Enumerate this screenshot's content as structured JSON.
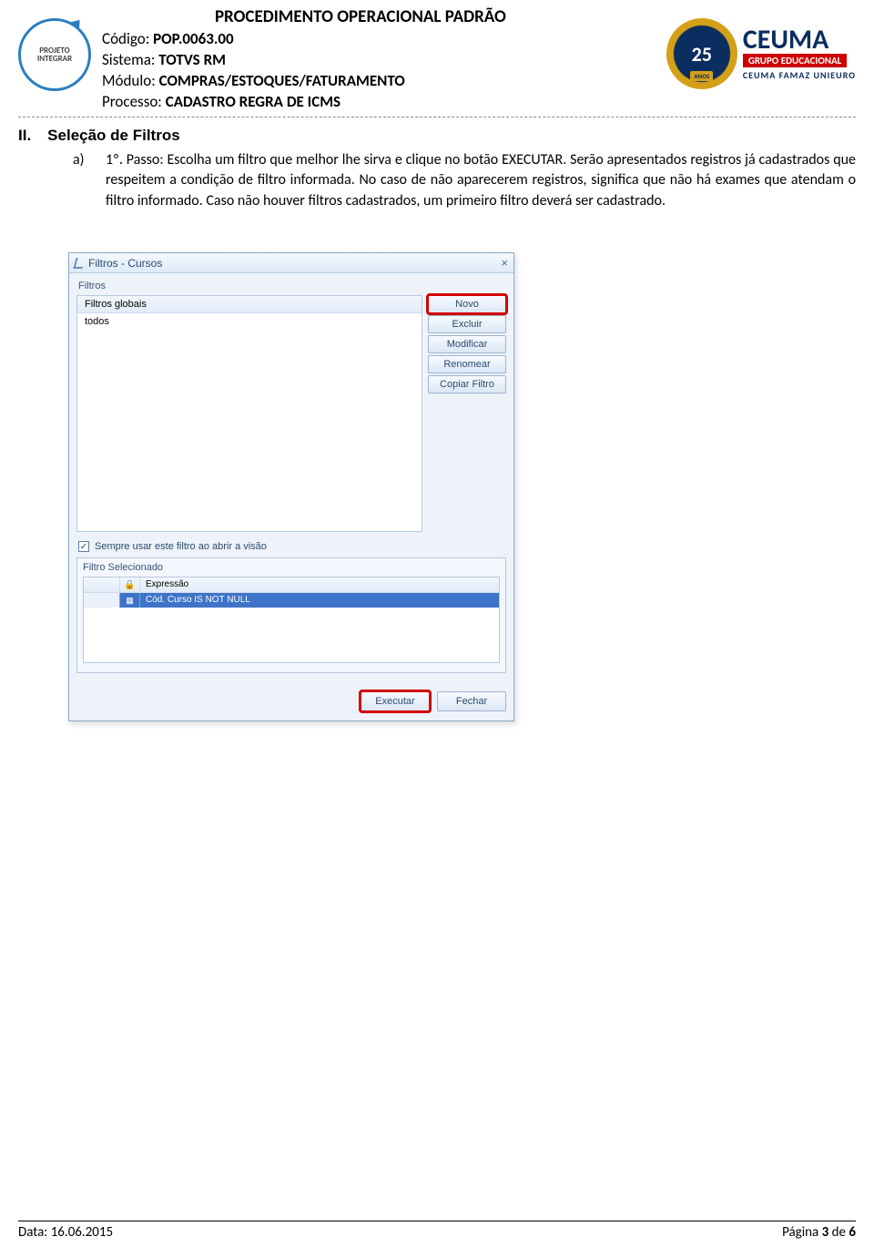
{
  "header": {
    "title": "PROCEDIMENTO OPERACIONAL PADRÃO",
    "codigo_label": "Código: ",
    "codigo_value": "POP.0063.00",
    "sistema_label": "Sistema: ",
    "sistema_value": "TOTVS RM",
    "modulo_label": "Módulo: ",
    "modulo_value": "COMPRAS/ESTOQUES/FATURAMENTO",
    "processo_label": "Processo: ",
    "processo_value": "CADASTRO REGRA DE ICMS",
    "logo_integrar_line1": "PROJETO",
    "logo_integrar_line2": "INTEGRAR",
    "badge_number": "25",
    "ceuma_main": "CEUMA",
    "ceuma_sub": "GRUPO EDUCACIONAL",
    "ceuma_line": "CEUMA FAMAZ UNIEURO"
  },
  "section": {
    "num": "II.",
    "title": "Seleção de Filtros",
    "item_letter": "a)",
    "item_text": "1º. Passo: Escolha um filtro que melhor lhe sirva e clique no botão EXECUTAR. Serão apresentados registros já cadastrados que respeitem a condição de filtro informada. No caso de não aparecerem registros, significa que não há exames que atendam o filtro informado. Caso não houver filtros cadastrados, um primeiro filtro deverá ser cadastrado."
  },
  "window": {
    "title": "Filtros - Cursos",
    "close": "×",
    "group_filtros": "Filtros",
    "list_header": "Filtros globais",
    "list_item": "todos",
    "buttons": {
      "novo": "Novo",
      "excluir": "Excluir",
      "modificar": "Modificar",
      "renomear": "Renomear",
      "copiar": "Copiar Filtro"
    },
    "checkbox_label": "Sempre usar este filtro ao abrir a visão",
    "sel_group": "Filtro Selecionado",
    "col_expressao": "Expressão",
    "row_expr": "Cód. Curso IS NOT NULL",
    "executar": "Executar",
    "fechar": "Fechar"
  },
  "footer": {
    "data": "Data: 16.06.2015",
    "pagina_pre": "Página ",
    "pagina_num": "3",
    "pagina_mid": " de ",
    "pagina_total": "6"
  }
}
